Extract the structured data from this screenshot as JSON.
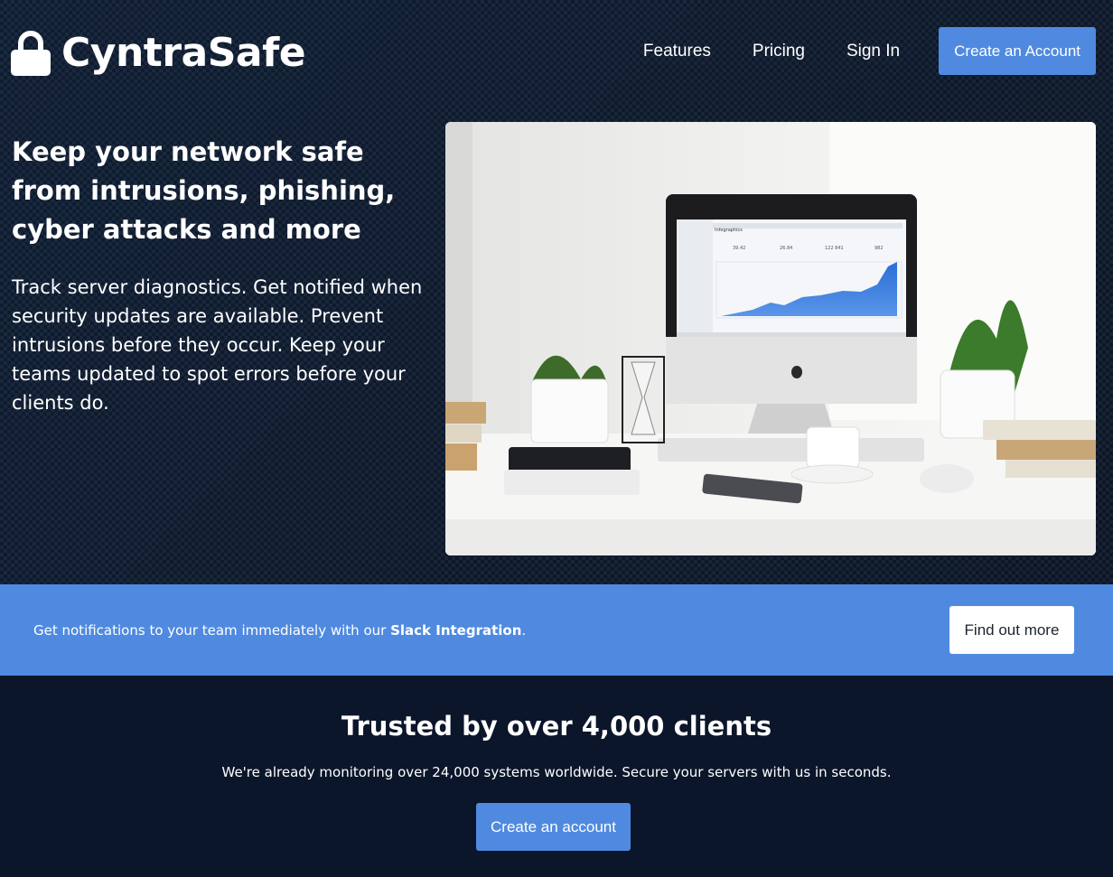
{
  "brand": {
    "name": "CyntraSafe",
    "logo_icon": "lock-icon"
  },
  "nav": {
    "items": [
      {
        "label": "Features"
      },
      {
        "label": "Pricing"
      },
      {
        "label": "Sign In"
      }
    ],
    "cta_label": "Create an Account"
  },
  "hero": {
    "title": "Keep your network safe from intrusions, phishing, cyber attacks and more",
    "body": "Track server diagnostics. Get notified when security updates are available. Prevent intrusions before they occur. Keep your teams updated to spot errors before your clients do.",
    "image": {
      "description_icon": "desk-monitor-photo",
      "screen_title": "Infographics",
      "screen_stats": [
        "39.42",
        "26.84",
        "122 841",
        "982"
      ]
    }
  },
  "banner": {
    "text_before": "Get notifications to your team immediately with our ",
    "text_bold": "Slack Integration",
    "text_after": ".",
    "button_label": "Find out more"
  },
  "trusted": {
    "title": "Trusted by over 4,000 clients",
    "subtitle": "We're already monitoring over 24,000 systems worldwide. Secure your servers with us in seconds.",
    "button_label": "Create an account"
  },
  "colors": {
    "accent": "#4f8ae0",
    "background_dark": "#0b162b",
    "white": "#ffffff"
  }
}
